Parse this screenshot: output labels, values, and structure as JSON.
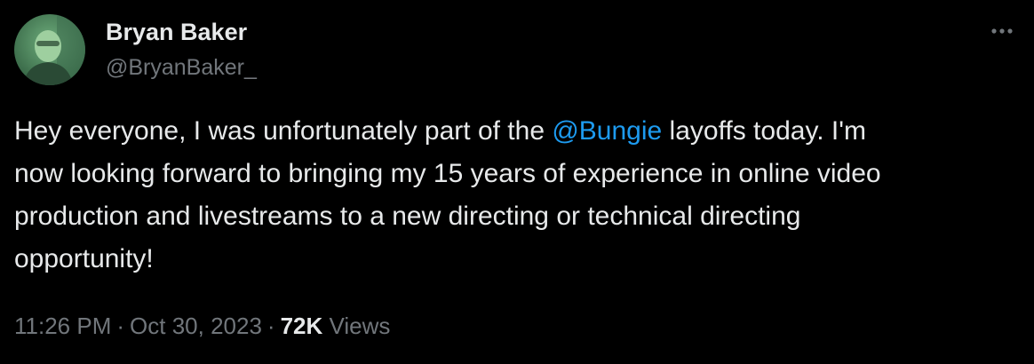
{
  "author": {
    "display_name": "Bryan Baker",
    "handle": "@BryanBaker_"
  },
  "more_icon": "more-horizontal-icon",
  "tweet": {
    "line1_before": "Hey everyone, I was unfortunately part of the ",
    "mention": "@Bungie",
    "line1_after": "  layoffs today. I'm",
    "line2": "now looking forward to bringing my 15 years of experience in online video",
    "line3": "production and livestreams to a new directing or technical directing",
    "line4": "opportunity!"
  },
  "meta": {
    "time": "11:26 PM",
    "separator": "·",
    "date": "Oct 30, 2023",
    "views_count": "72K",
    "views_label": "Views"
  },
  "colors": {
    "background": "#000000",
    "text": "#e7e9ea",
    "secondary": "#71767b",
    "link": "#1d9bf0"
  }
}
